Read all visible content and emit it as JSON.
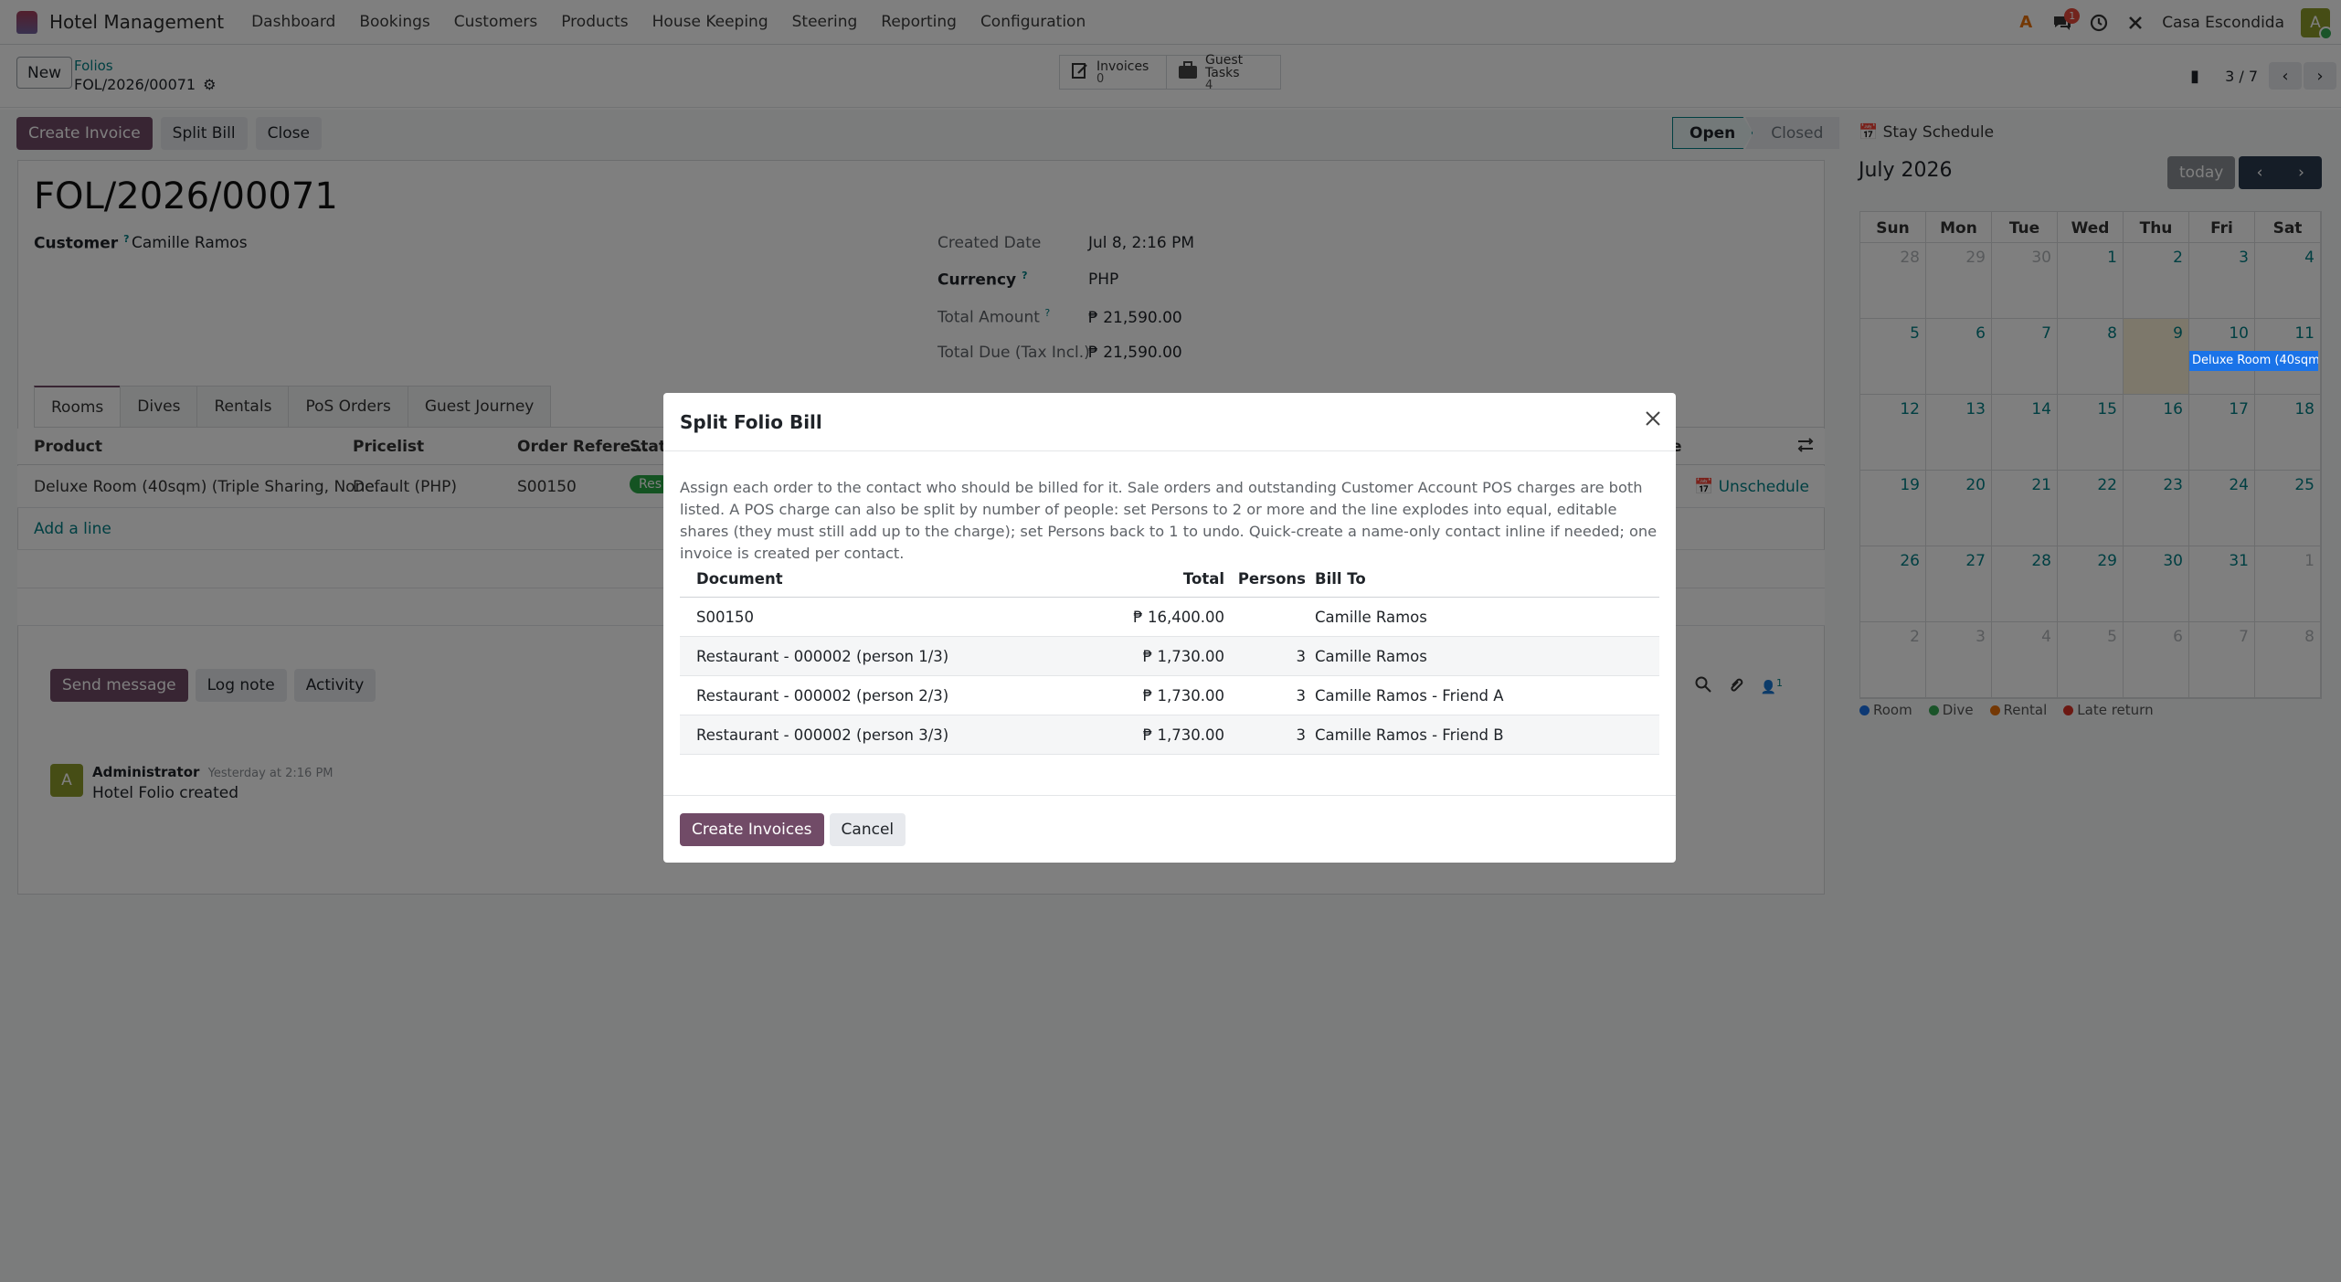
{
  "navbar": {
    "app_name": "Hotel Management",
    "menu": [
      "Dashboard",
      "Bookings",
      "Customers",
      "Products",
      "House Keeping",
      "Steering",
      "Reporting",
      "Configuration"
    ],
    "chat_badge": "1",
    "company": "Casa Escondida",
    "avatar": "A"
  },
  "control": {
    "new_label": "New",
    "breadcrumb_parent": "Folios",
    "breadcrumb_current": "FOL/2026/00071",
    "smart_invoices_label": "Invoices",
    "smart_invoices_count": "0",
    "smart_tasks_label": "Guest Tasks",
    "smart_tasks_count": "4",
    "pager": "3 / 7"
  },
  "actions": {
    "create_invoice": "Create Invoice",
    "split_bill": "Split Bill",
    "close": "Close"
  },
  "statusbar": {
    "open": "Open",
    "closed": "Closed"
  },
  "form": {
    "title": "FOL/2026/00071",
    "customer_label": "Customer",
    "customer_value": "Camille Ramos",
    "created_label": "Created Date",
    "created_value": "Jul 8, 2:16 PM",
    "currency_label": "Currency",
    "currency_value": "PHP",
    "total_label": "Total Amount",
    "total_value": "₱ 21,590.00",
    "due_label": "Total Due (Tax Incl.)",
    "due_value": "₱ 21,590.00",
    "help_mark": "?"
  },
  "tabs": [
    "Rooms",
    "Dives",
    "Rentals",
    "PoS Orders",
    "Guest Journey"
  ],
  "rooms_table": {
    "headers": {
      "product": "Product",
      "pricelist": "Pricelist",
      "order_ref": "Order Refere...",
      "state": "State",
      "extra": "e"
    },
    "row": {
      "product": "Deluxe Room (40sqm) (Triple Sharing, None...",
      "pricelist": "Default (PHP)",
      "order_ref": "S00150",
      "state": "Res",
      "unschedule": "Unschedule"
    },
    "add_line": "Add a line"
  },
  "chatter": {
    "send": "Send message",
    "log": "Log note",
    "activity": "Activity",
    "followers": "1",
    "author": "Administrator",
    "time": "Yesterday at 2:16 PM",
    "body": "Hotel Folio created",
    "avatar": "A"
  },
  "calendar": {
    "title": "Stay Schedule",
    "month": "July 2026",
    "today": "today",
    "weekdays": [
      "Sun",
      "Mon",
      "Tue",
      "Wed",
      "Thu",
      "Fri",
      "Sat"
    ],
    "weeks": [
      [
        "28",
        "29",
        "30",
        "1",
        "2",
        "3",
        "4"
      ],
      [
        "5",
        "6",
        "7",
        "8",
        "9",
        "10",
        "11"
      ],
      [
        "12",
        "13",
        "14",
        "15",
        "16",
        "17",
        "18"
      ],
      [
        "19",
        "20",
        "21",
        "22",
        "23",
        "24",
        "25"
      ],
      [
        "26",
        "27",
        "28",
        "29",
        "30",
        "31",
        "1"
      ],
      [
        "2",
        "3",
        "4",
        "5",
        "6",
        "7",
        "8"
      ]
    ],
    "event": "Deluxe Room (40sqm",
    "legend": [
      {
        "label": "Room",
        "color": "#1a73e8"
      },
      {
        "label": "Dive",
        "color": "#34a853"
      },
      {
        "label": "Rental",
        "color": "#e8710a"
      },
      {
        "label": "Late return",
        "color": "#d93025"
      }
    ]
  },
  "modal": {
    "title": "Split Folio Bill",
    "description": "Assign each order to the contact who should be billed for it. Sale orders and outstanding Customer Account POS charges are both listed. A POS charge can also be split by number of people: set Persons to 2 or more and the line explodes into equal, editable shares (they must still add up to the charge); set Persons back to 1 to undo. Quick-create a name-only contact inline if needed; one invoice is created per contact.",
    "headers": {
      "document": "Document",
      "total": "Total",
      "persons": "Persons",
      "bill_to": "Bill To"
    },
    "rows": [
      {
        "document": "S00150",
        "total": "₱ 16,400.00",
        "persons": "",
        "bill_to": "Camille Ramos"
      },
      {
        "document": "Restaurant - 000002 (person 1/3)",
        "total": "₱ 1,730.00",
        "persons": "3",
        "bill_to": "Camille Ramos"
      },
      {
        "document": "Restaurant - 000002 (person 2/3)",
        "total": "₱ 1,730.00",
        "persons": "3",
        "bill_to": "Camille Ramos - Friend A"
      },
      {
        "document": "Restaurant - 000002 (person 3/3)",
        "total": "₱ 1,730.00",
        "persons": "3",
        "bill_to": "Camille Ramos - Friend B"
      }
    ],
    "create": "Create Invoices",
    "cancel": "Cancel"
  }
}
